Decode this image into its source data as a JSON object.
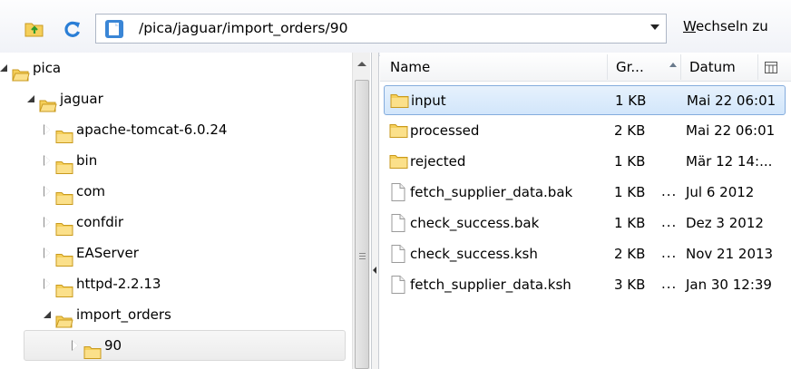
{
  "toolbar": {
    "path": "/pica/jaguar/import_orders/90",
    "go_label_accel": "W",
    "go_label_rest": "echseln zu"
  },
  "tree": {
    "items": [
      {
        "label": "pica",
        "state": "open"
      },
      {
        "label": "jaguar",
        "state": "open"
      },
      {
        "label": "apache-tomcat-6.0.24",
        "state": "closed"
      },
      {
        "label": "bin",
        "state": "closed"
      },
      {
        "label": "com",
        "state": "closed"
      },
      {
        "label": "confdir",
        "state": "closed"
      },
      {
        "label": "EAServer",
        "state": "closed"
      },
      {
        "label": "httpd-2.2.13",
        "state": "closed"
      },
      {
        "label": "import_orders",
        "state": "open"
      },
      {
        "label": "90",
        "state": "closed",
        "selected": true
      }
    ]
  },
  "filelist": {
    "columns": {
      "name": "Name",
      "size": "Gr...",
      "date": "Datum"
    },
    "sort": "size-ascending",
    "rows": [
      {
        "type": "folder",
        "name": "input",
        "size": "1 KB",
        "dots": "",
        "date": "Mai 22 06:01",
        "selected": true
      },
      {
        "type": "folder",
        "name": "processed",
        "size": "2 KB",
        "dots": "",
        "date": "Mai 22 06:01"
      },
      {
        "type": "folder",
        "name": "rejected",
        "size": "1 KB",
        "dots": "",
        "date": "Mär 12 14:..."
      },
      {
        "type": "file",
        "name": "fetch_supplier_data.bak",
        "size": "1 KB",
        "dots": "...",
        "date": "Jul 6 2012"
      },
      {
        "type": "file",
        "name": "check_success.bak",
        "size": "1 KB",
        "dots": "...",
        "date": "Dez 3 2012"
      },
      {
        "type": "file",
        "name": "check_success.ksh",
        "size": "2 KB",
        "dots": "...",
        "date": "Nov 21 2013"
      },
      {
        "type": "file",
        "name": "fetch_supplier_data.ksh",
        "size": "3 KB",
        "dots": "...",
        "date": "Jan 30 12:39"
      }
    ]
  },
  "colors": {
    "folder": "#f5cf5a",
    "folder_edge": "#c99a1d",
    "selection_border": "#84acdd",
    "selection_fill": "#d7e8fb"
  }
}
